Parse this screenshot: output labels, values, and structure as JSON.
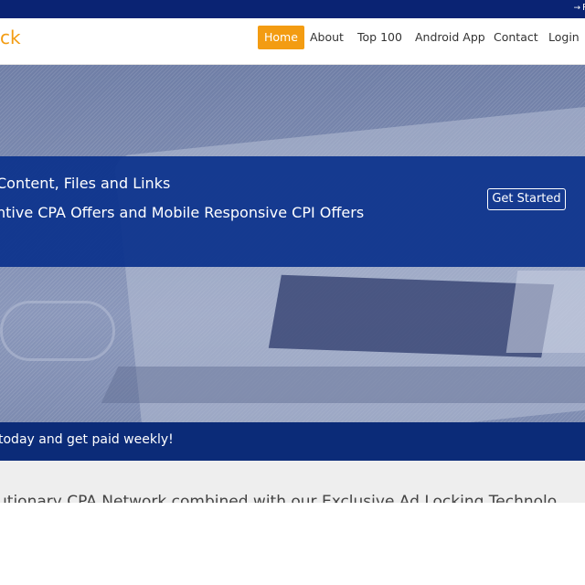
{
  "topbar": {
    "register_label": "R"
  },
  "brand": {
    "text": "ck"
  },
  "nav": {
    "items": [
      {
        "label": "Home",
        "active": true
      },
      {
        "label": "About"
      },
      {
        "label": "Top 100"
      },
      {
        "label": "Android App"
      },
      {
        "label": "Contact"
      },
      {
        "label": "Login"
      }
    ]
  },
  "hero": {
    "line1": "Content, Files and Links",
    "line2": "ntive CPA Offers and Mobile Responsive CPI Offers",
    "cta_label": "Get Started"
  },
  "strip": {
    "text": "today and get paid weekly!"
  },
  "lower": {
    "text": "utionary CPA Network combined with our Exclusive Ad Locking Technolo"
  },
  "colors": {
    "topbar": "#0a2373",
    "accent": "#f39c12",
    "hero_band": "#0b328c",
    "strip": "#0b2b78"
  }
}
